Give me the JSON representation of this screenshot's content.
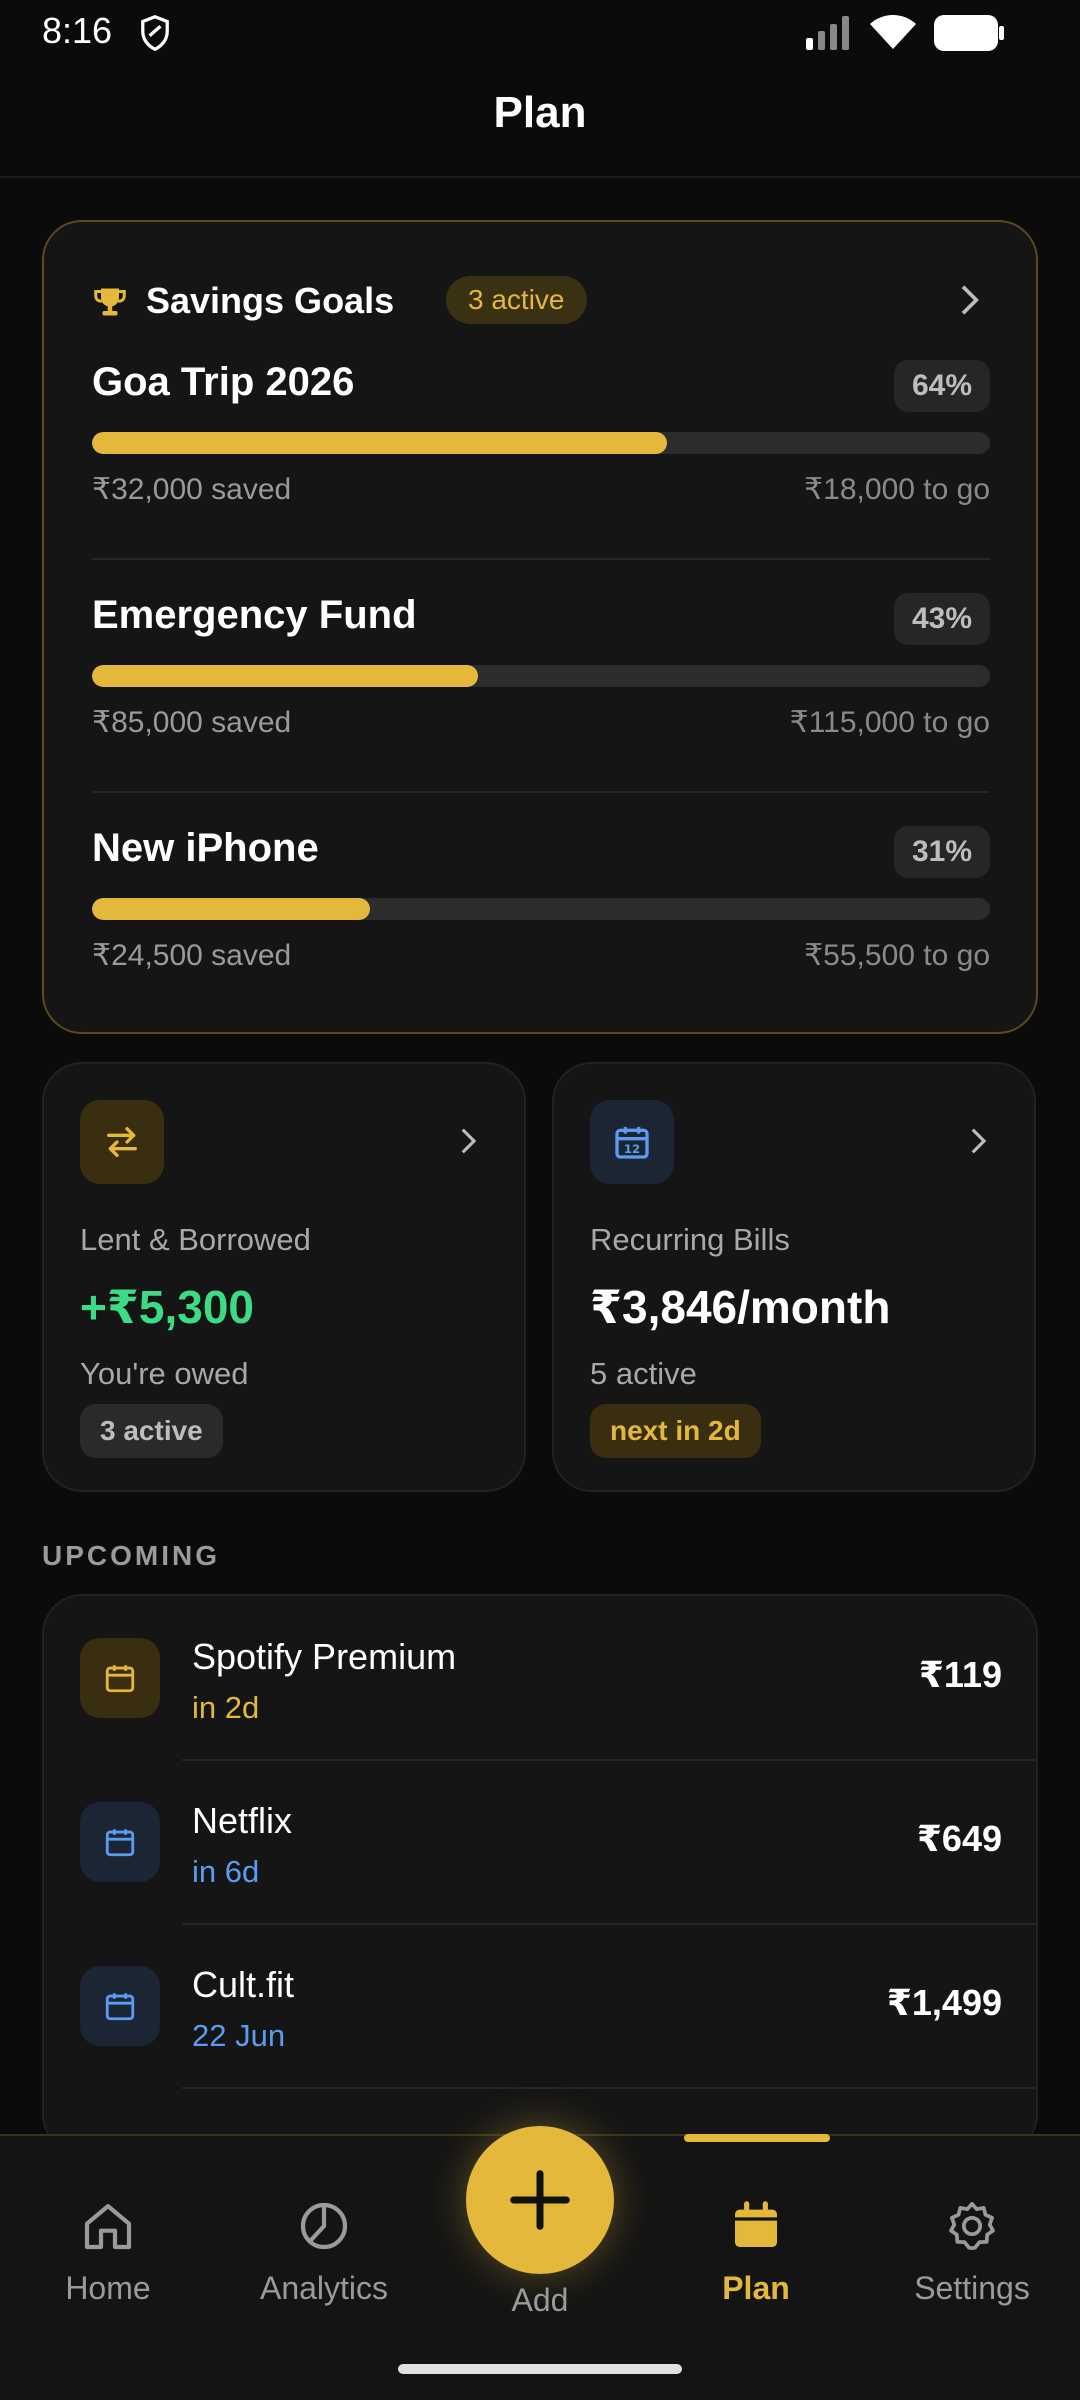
{
  "status_bar": {
    "time": "8:16"
  },
  "app_bar": {
    "title": "Plan"
  },
  "savings_goals": {
    "title": "Savings Goals",
    "badge": "3 active",
    "goals": [
      {
        "name": "Goa Trip 2026",
        "percent_label": "64%",
        "progress": 0.64,
        "saved": "₹32,000 saved",
        "to_go": "₹18,000 to go"
      },
      {
        "name": "Emergency Fund",
        "percent_label": "43%",
        "progress": 0.43,
        "saved": "₹85,000 saved",
        "to_go": "₹115,000 to go"
      },
      {
        "name": "New iPhone",
        "percent_label": "31%",
        "progress": 0.31,
        "saved": "₹24,500 saved",
        "to_go": "₹55,500 to go"
      }
    ]
  },
  "lent_borrowed": {
    "label": "Lent & Borrowed",
    "value": "+₹5,300",
    "sub": "You're owed",
    "pill": "3 active"
  },
  "recurring_bills": {
    "label": "Recurring Bills",
    "value": "₹3,846/month",
    "sub": "5 active",
    "pill": "next in 2d"
  },
  "upcoming": {
    "label": "UPCOMING",
    "items": [
      {
        "name": "Spotify Premium",
        "when": "in 2d",
        "amount": "₹119"
      },
      {
        "name": "Netflix",
        "when": "in 6d",
        "amount": "₹649"
      },
      {
        "name": "Cult.fit",
        "when": "22 Jun",
        "amount": "₹1,499"
      }
    ]
  },
  "bottom_nav": {
    "items": [
      {
        "label": "Home",
        "icon": "home-icon"
      },
      {
        "label": "Analytics",
        "icon": "analytics-icon"
      },
      {
        "label": "Add",
        "icon": "plus-icon"
      },
      {
        "label": "Plan",
        "icon": "calendar-icon",
        "active": true
      },
      {
        "label": "Settings",
        "icon": "gear-icon"
      }
    ]
  },
  "colors": {
    "accent": "#e3b83b",
    "positive": "#3ddc84",
    "info": "#5b9cf0",
    "background": "#0b0b0b",
    "card": "#151515"
  }
}
